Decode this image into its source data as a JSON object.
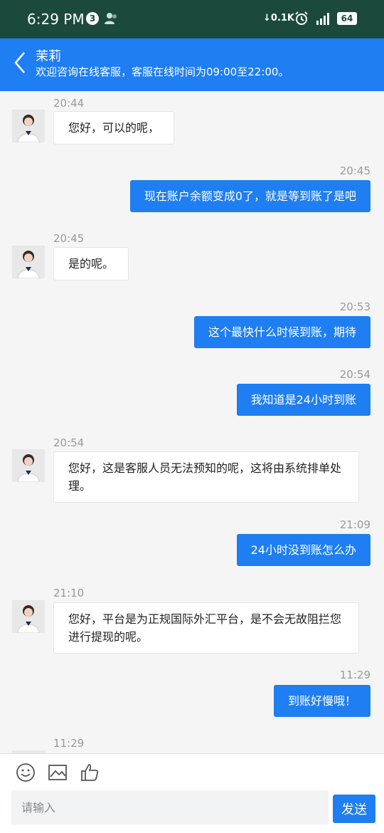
{
  "status_bar": {
    "time": "6:29 PM",
    "notification_count": "3",
    "network_speed": "0.1K",
    "battery": "64"
  },
  "header": {
    "title": "茉莉",
    "subtitle": "欢迎咨询在线客服，客服在线时间为09:00至22:00。"
  },
  "messages": [
    {
      "time": "20:44",
      "sender": "agent",
      "text": "您好，可以的呢，"
    },
    {
      "time": "20:45",
      "sender": "user",
      "text": "现在账户余额变成0了，就是等到账了是吧"
    },
    {
      "time": "20:45",
      "sender": "agent",
      "text": "是的呢。"
    },
    {
      "time": "20:53",
      "sender": "user",
      "text": "这个最快什么时候到账，期待"
    },
    {
      "time": "20:54",
      "sender": "user",
      "text": "我知道是24小时到账"
    },
    {
      "time": "20:54",
      "sender": "agent",
      "text": "您好，这是客服人员无法预知的呢，这将由系统排单处理。"
    },
    {
      "time": "21:09",
      "sender": "user",
      "text": "24小时没到账怎么办"
    },
    {
      "time": "21:10",
      "sender": "agent",
      "text": "您好，平台是为正规国际外汇平台，是不会无故阻拦您进行提现的呢。"
    },
    {
      "time": "11:29",
      "sender": "user",
      "text": "到账好慢哦！"
    },
    {
      "time": "11:29",
      "sender": "agent",
      "text": ""
    }
  ],
  "input": {
    "placeholder": "请输入",
    "send_label": "发送"
  },
  "colors": {
    "accent": "#1e7ef2",
    "status_bar": "#1b4a3c"
  }
}
